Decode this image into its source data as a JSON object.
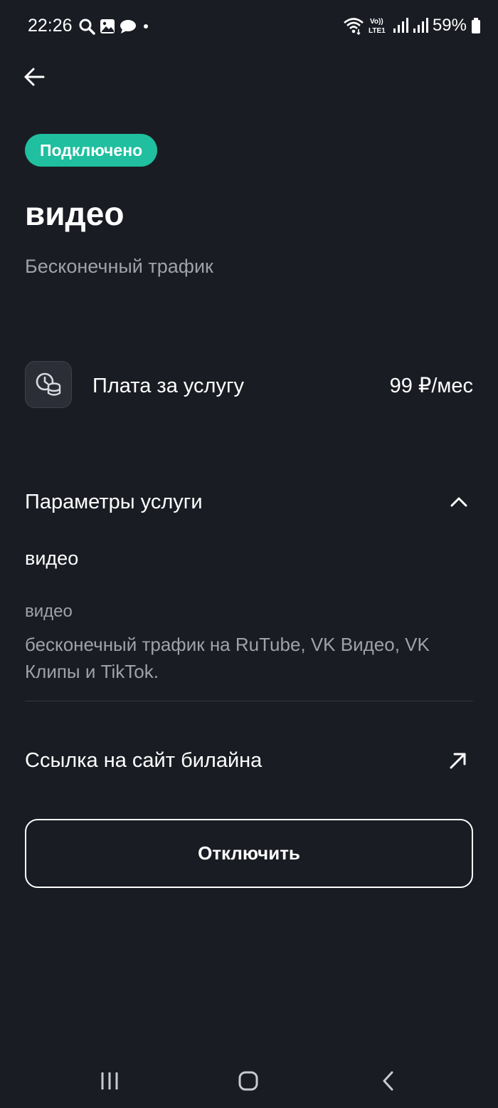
{
  "status_bar": {
    "time": "22:26",
    "battery": "59%",
    "icons_left": [
      "search-icon",
      "image-icon",
      "chat-icon",
      "dot-icon"
    ],
    "icons_right": [
      "wifi-icon",
      "volte-icon",
      "signal-icon",
      "signal-icon",
      "battery-icon"
    ],
    "volte_label": "Vo)) LTE1"
  },
  "header": {
    "back_icon": "arrow-left-icon"
  },
  "service": {
    "status_badge": "Подключено",
    "title": "видео",
    "subtitle": "Бесконечный трафик"
  },
  "fee": {
    "icon": "clock-coins-icon",
    "label": "Плата за услугу",
    "value": "99 ₽/мес"
  },
  "params": {
    "header": "Параметры услуги",
    "toggle_icon": "chevron-up-icon",
    "name": "видео",
    "caption": "видео",
    "description": "бесконечный трафик на RuTube, VK Видео, VK Клипы и TikTok."
  },
  "link": {
    "label": "Ссылка на сайт билайна",
    "icon": "external-arrow-icon"
  },
  "actions": {
    "disable_label": "Отключить"
  },
  "nav_bar": {
    "items": [
      "recent-apps-icon",
      "home-icon",
      "back-icon"
    ]
  },
  "colors": {
    "background": "#1a1c23",
    "badge": "#1fbf9f",
    "secondary_text": "#9fa2aa"
  }
}
